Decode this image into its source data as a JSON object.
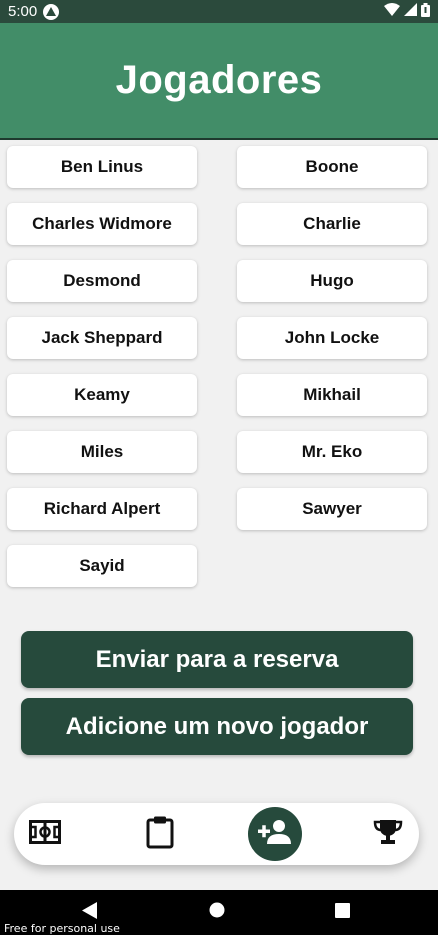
{
  "status_bar": {
    "time": "5:00",
    "app_icon": "app-badge-icon",
    "indicators": [
      "wifi-icon",
      "signal-icon",
      "battery-icon"
    ]
  },
  "header": {
    "title": "Jogadores"
  },
  "players": [
    "Ben Linus",
    "Boone",
    "Charles Widmore",
    "Charlie",
    "Desmond",
    "Hugo",
    "Jack Sheppard",
    "John Locke",
    "Keamy",
    "Mikhail",
    "Miles",
    "Mr. Eko",
    "Richard Alpert",
    "Sawyer",
    "Sayid"
  ],
  "actions": {
    "send_to_reserve": "Enviar para a reserva",
    "add_new_player": "Adicione um novo jogador"
  },
  "bottom_nav": {
    "items": [
      {
        "icon": "soccer-field-icon",
        "active": false
      },
      {
        "icon": "clipboard-icon",
        "active": false
      },
      {
        "icon": "add-person-icon",
        "active": true
      },
      {
        "icon": "trophy-icon",
        "active": false
      }
    ]
  },
  "watermark": "Free for personal use",
  "colors": {
    "header": "#428d68",
    "status_bar": "#2b4a3c",
    "button": "#264a3c",
    "background": "#f1f1f1"
  }
}
